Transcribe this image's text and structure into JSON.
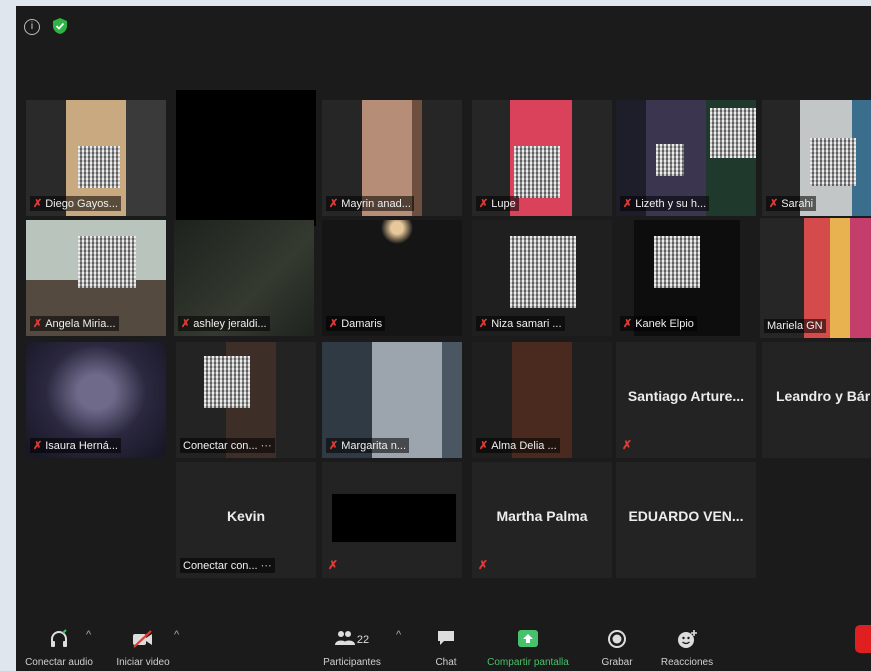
{
  "toolbar": {
    "audio_label": "Conectar audio",
    "video_label": "Iniciar video",
    "participants_label": "Participantes",
    "participants_count": "22",
    "chat_label": "Chat",
    "share_label": "Compartir pantalla",
    "record_label": "Grabar",
    "reactions_label": "Reacciones"
  },
  "participants": [
    {
      "name": "Diego Gayos..."
    },
    {
      "name": "Mayrin anad..."
    },
    {
      "name": "Lupe"
    },
    {
      "name": "Lizeth y su h..."
    },
    {
      "name": "Sarahi"
    },
    {
      "name": "Angela Miria..."
    },
    {
      "name": "ashley jeraldi..."
    },
    {
      "name": "Damaris"
    },
    {
      "name": "Niza samari ..."
    },
    {
      "name": "Kanek Elpio"
    },
    {
      "name": "Mariela GN"
    },
    {
      "name": "Isaura Herná..."
    },
    {
      "name": "Conectar con..."
    },
    {
      "name": "Margarita n..."
    },
    {
      "name": "Alma Delia ..."
    },
    {
      "name": "Santiago  Arture..."
    },
    {
      "name": "Leandro y Bárb"
    },
    {
      "name": "Kevin",
      "sub": "Conectar con..."
    },
    {
      "name": "Martha Palma"
    },
    {
      "name": "EDUARDO  VEN..."
    }
  ],
  "colors": {
    "muted_mic": "#e53935",
    "share_green": "#47c16b",
    "active_speaker": "#d6c04a"
  }
}
